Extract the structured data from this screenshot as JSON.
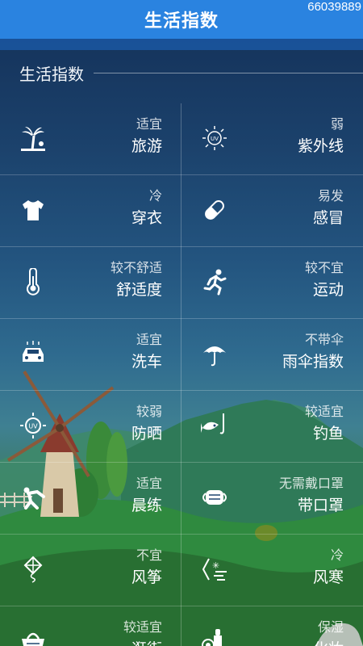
{
  "header": {
    "title": "生活指数",
    "code": "66039889"
  },
  "section": {
    "title": "生活指数"
  },
  "indices": [
    {
      "level": "适宜",
      "name": "旅游",
      "icon": "palm-tree-icon"
    },
    {
      "level": "弱",
      "name": "紫外线",
      "icon": "uv-sun-icon"
    },
    {
      "level": "冷",
      "name": "穿衣",
      "icon": "tshirt-icon"
    },
    {
      "level": "易发",
      "name": "感冒",
      "icon": "pill-capsule-icon"
    },
    {
      "level": "较不舒适",
      "name": "舒适度",
      "icon": "thermometer-icon"
    },
    {
      "level": "较不宜",
      "name": "运动",
      "icon": "running-person-icon"
    },
    {
      "level": "适宜",
      "name": "洗车",
      "icon": "car-wash-icon"
    },
    {
      "level": "不带伞",
      "name": "雨伞指数",
      "icon": "umbrella-icon"
    },
    {
      "level": "较弱",
      "name": "防晒",
      "icon": "sunscreen-uv-icon"
    },
    {
      "level": "较适宜",
      "name": "钓鱼",
      "icon": "fish-hook-icon"
    },
    {
      "level": "适宜",
      "name": "晨练",
      "icon": "stretching-person-icon"
    },
    {
      "level": "无需戴口罩",
      "name": "带口罩",
      "icon": "face-mask-icon"
    },
    {
      "level": "不宜",
      "name": "风筝",
      "icon": "kite-icon"
    },
    {
      "level": "冷",
      "name": "风寒",
      "icon": "wind-chill-icon"
    },
    {
      "level": "较适宜",
      "name": "逛街",
      "icon": "shopping-basket-icon"
    },
    {
      "level": "保湿",
      "name": "化妆",
      "icon": "cosmetics-icon"
    }
  ],
  "colors": {
    "header_bg": "#2a83e0",
    "text": "#ffffff"
  }
}
